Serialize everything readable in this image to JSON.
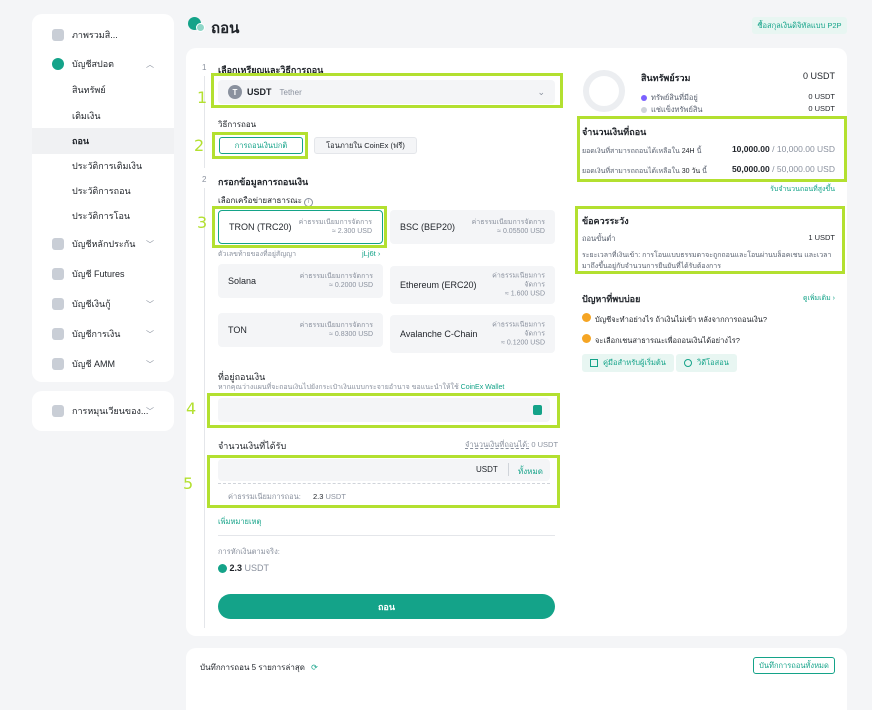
{
  "page": {
    "title": "ถอน",
    "p2p_button": "ซื้อสกุลเงินดิจิทัลแบบ P2P"
  },
  "sidebar": {
    "items": [
      {
        "label": "ภาพรวมสิ...",
        "icon": "overview-icon"
      },
      {
        "label": "บัญชีสปอต",
        "icon": "spot-account-icon",
        "expanded": true
      },
      {
        "label": "สินทรัพย์",
        "sub": true
      },
      {
        "label": "เติมเงิน",
        "sub": true
      },
      {
        "label": "ถอน",
        "sub": true,
        "active": true
      },
      {
        "label": "ประวัติการเติมเงิน",
        "sub": true
      },
      {
        "label": "ประวัติการถอน",
        "sub": true
      },
      {
        "label": "ประวัติการโอน",
        "sub": true
      },
      {
        "label": "บัญชีหลักประกัน",
        "icon": "margin-icon"
      },
      {
        "label": "บัญชี Futures",
        "icon": "futures-icon"
      },
      {
        "label": "บัญชีเงินกู้",
        "icon": "loan-icon"
      },
      {
        "label": "บัญชีการเงิน",
        "icon": "finance-icon"
      },
      {
        "label": "บัญชี AMM",
        "icon": "amm-icon"
      }
    ],
    "secondary": {
      "label": "การหมุนเวียนของ...",
      "icon": "circulation-icon"
    }
  },
  "form": {
    "step1": {
      "num": "1",
      "title": "เลือกเหรียญและวิธีการถอน"
    },
    "coin": {
      "symbol": "USDT",
      "name": "Tether",
      "icon_letter": "T"
    },
    "method_label": "วิธีการถอน",
    "methods": [
      "การถอนเงินปกติ",
      "โอนภายใน CoinEx (ฟรี)"
    ],
    "step2": {
      "num": "2",
      "title": "กรอกข้อมูลการถอนเงิน"
    },
    "network_label": "เลือกเครือข่ายสาธารณะ",
    "contract_hint": "ตัวเลขท้ายของที่อยู่สัญญา",
    "contract_link": "jLj6t ›",
    "networks": [
      {
        "name": "TRON (TRC20)",
        "fee_label": "ค่าธรรมเนียมการจัดการ",
        "fee": "≈ 2.300 USD"
      },
      {
        "name": "BSC (BEP20)",
        "fee_label": "ค่าธรรมเนียมการจัดการ",
        "fee": "≈ 0.05500 USD"
      },
      {
        "name": "Solana",
        "fee_label": "ค่าธรรมเนียมการจัดการ",
        "fee": "≈ 0.2000 USD"
      },
      {
        "name": "Ethereum (ERC20)",
        "fee_label": "ค่าธรรมเนียมการจัดการ",
        "fee": "≈ 1.600 USD"
      },
      {
        "name": "TON",
        "fee_label": "ค่าธรรมเนียมการจัดการ",
        "fee": "≈ 0.8300 USD"
      },
      {
        "name": "Avalanche C-Chain",
        "fee_label": "ค่าธรรมเนียมการจัดการ",
        "fee": "≈ 0.1200 USD"
      }
    ],
    "address_label": "ที่อยู่ถอนเงิน",
    "address_hint": "หากคุณว่างแผนที่จะถอนเงินไปยังกระเป๋าเงินแบบกระจายอำนาจ ขอแนะนำให้ใช้",
    "address_hint_link": "CoinEx Wallet",
    "address_value": "",
    "receive_label": "จำนวนเงินที่ได้รับ",
    "available_label": "จำนวนเงินที่ถอนได้:",
    "available_value": "0 USDT",
    "amount_unit": "USDT",
    "amount_all": "ทั้งหมด",
    "fee_label": "ค่าธรรมเนียมการถอน:",
    "fee_value": "2.3",
    "fee_unit": "USDT",
    "add_note": "เพิ่มหมายเหตุ",
    "actual_label": "การหักเงินตามจริง:",
    "actual_value": "2.3",
    "actual_unit": "USDT",
    "submit": "ถอน"
  },
  "highlights": [
    "1",
    "2",
    "3",
    "4",
    "5"
  ],
  "right": {
    "total_label": "สินทรัพย์รวม",
    "total_value": "0 USDT",
    "available_label": "ทรัพย์สินที่มีอยู่",
    "available_value": "0 USDT",
    "frozen_label": "แช่แข็งทรัพย์สิน",
    "frozen_value": "0 USDT",
    "colors": {
      "available": "#7b61ff",
      "frozen": "#d0d4da"
    },
    "limit": {
      "title": "จำนวนเงินที่ถอน",
      "row1_label": "ยอดเงินที่สามารถถอนได้เหลือใน",
      "row1_period": "24H",
      "row1_suffix": "นี้",
      "row1_value": "10,000.00",
      "row1_total": "/ 10,000.00 USD",
      "row2_label": "ยอดเงินที่สามารถถอนได้เหลือใน",
      "row2_period": "30 วัน",
      "row2_suffix": "นี้",
      "row2_value": "50,000.00",
      "row2_total": "/ 50,000.00 USD",
      "raise_link": "รับจำนวนถอนที่สูงขึ้น"
    },
    "notice": {
      "title": "ข้อควรระวัง",
      "min_label": "ถอนขั้นต่ำ",
      "min_value": "1 USDT",
      "text": "ระยะเวลาที่เงินเข้า: การโอนแบบธรรมดาจะถูกถอนและโอนผ่านบล็อคเชน และเวลามาถึงขึ้นอยู่กับจำนวนการยืนยันที่ได้รับต้องการ"
    },
    "faq": {
      "title": "ปัญหาที่พบบ่อย",
      "more": "ดูเพิ่มเติม ›",
      "q1": "บัญชีจะทำอย่างไร ถ้าเงินไม่เข้า หลังจากการถอนเงิน?",
      "q2": "จะเลือกเชนสาธารณะเพื่อถอนเงินได้อย่างไร?",
      "guide": "คู่มือสำหรับผู้เริ่มต้น",
      "video": "วิดีโอสอน"
    }
  },
  "history": {
    "title": "บันทึกการถอน 5 รายการล่าสุด",
    "all_button": "บันทึกการถอนทั้งหมด"
  },
  "accent": "#14a389",
  "highlight_color": "#b3e030"
}
